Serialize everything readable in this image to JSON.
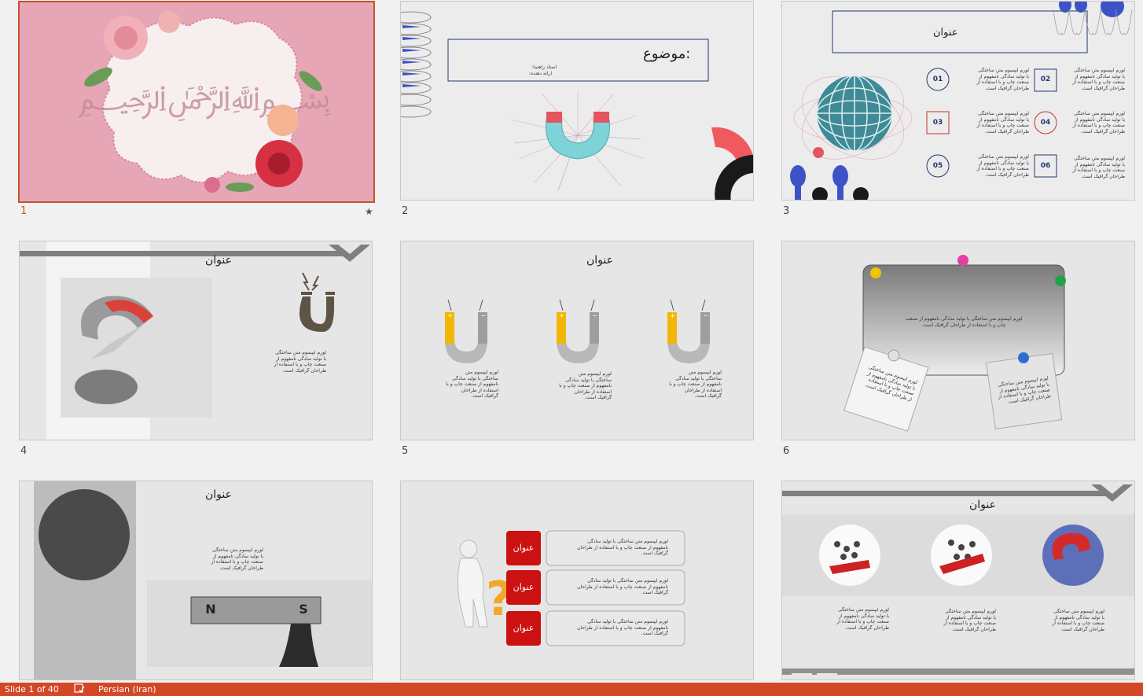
{
  "slides": [
    {
      "number": "1",
      "star": "★"
    },
    {
      "number": "2",
      "subject": "موضوع:",
      "advisor": "استاد راهنما:",
      "presenter": "ارائه دهنده:"
    },
    {
      "number": "3",
      "title": "عنوان",
      "badges": [
        "01",
        "02",
        "03",
        "04",
        "05",
        "06"
      ],
      "text": "لورم ایپسوم متن ساختگی\nبا تولید سادگی نامفهوم از\nصنعت چاپ و با استفاده از\nطراحان گرافیک است."
    },
    {
      "number": "4",
      "title": "عنوان",
      "text": "لورم ایپسوم متن ساختگی\nبا تولید سادگی نامفهوم از\nصنعت چاپ و با استفاده از\nطراحان گرافیک است."
    },
    {
      "number": "5",
      "title": "عنوان",
      "text": "لورم ایپسوم متن\nساختگی با تولید سادگی\nنامفهوم از صنعت چاپ و با\nاستفاده از طراحان\nگرافیک است.",
      "plus": "+",
      "minus": "−"
    },
    {
      "number": "6",
      "text": "لورم ایپسوم متن ساختگی با تولید سادگی نامفهوم از صنعت\nچاپ و با استفاده از طراحان گرافیک است.",
      "note": "لورم ایپسوم متن ساختگی با تولید سادگی نامفهوم از صنعت چاپ و با استفاده از طراحان گرافیک است."
    },
    {
      "number": "7",
      "title": "عنوان",
      "text": "لورم ایپسوم متن ساختگی\nبا تولید سادگی نامفهوم از\nصنعت چاپ و با استفاده از\nطراحان گرافیک است.",
      "n": "N",
      "s": "S"
    },
    {
      "number": "8",
      "label": "عنوان",
      "text": "لورم ایپسوم متن ساختگی با تولید سادگی\nنامفهوم از صنعت چاپ و با استفاده از طراحان\nگرافیک است."
    },
    {
      "number": "9",
      "title": "عنوان",
      "text": "لورم ایپسوم متن ساختگی\nبا تولید سادگی نامفهوم از\nصنعت چاپ و با استفاده از\nطراحان گرافیک است."
    }
  ],
  "status": {
    "slide": "Slide 1 of 40",
    "language": "Persian (Iran)"
  },
  "colors": {
    "accent": "#d24726",
    "red": "#cc1111",
    "navy": "#1f3a6e",
    "pink": "#e8a5b5"
  }
}
